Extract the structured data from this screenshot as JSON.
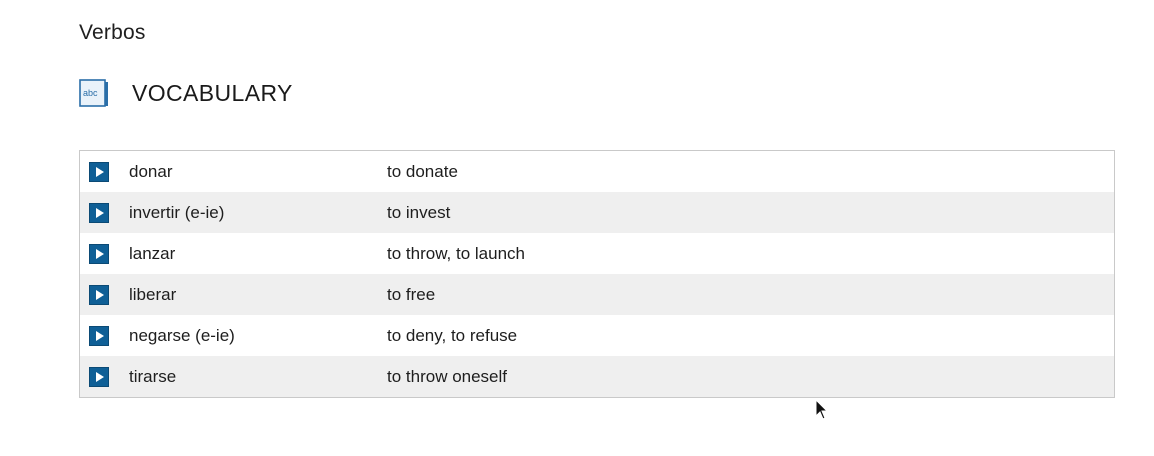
{
  "section": {
    "title": "Verbos"
  },
  "vocabulary": {
    "icon": "abc-vocabulary-icon",
    "icon_text": "abc",
    "title": "VOCABULARY",
    "rows": [
      {
        "term": "donar",
        "definition": "to donate"
      },
      {
        "term": "invertir (e-ie)",
        "definition": "to invest"
      },
      {
        "term": "lanzar",
        "definition": "to throw, to launch"
      },
      {
        "term": "liberar",
        "definition": "to free"
      },
      {
        "term": "negarse (e-ie)",
        "definition": "to deny, to refuse"
      },
      {
        "term": "tirarse",
        "definition": "to throw oneself"
      }
    ]
  },
  "colors": {
    "play_button": "#0f5f96",
    "row_alt": "#efefef",
    "table_border": "#c9c9c9"
  }
}
